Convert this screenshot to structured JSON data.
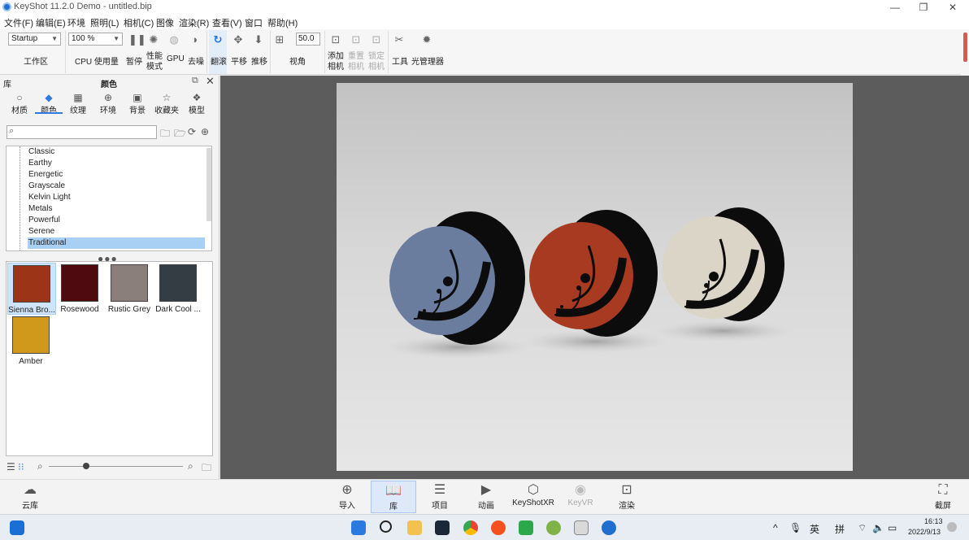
{
  "window": {
    "title": "KeyShot 11.2.0 Demo - untitled.bip",
    "controls": [
      "—",
      "❐",
      "✕"
    ]
  },
  "menu": [
    "文件(F)",
    "编辑(E)",
    "环境",
    "照明(L)",
    "相机(C)",
    "图像",
    "渲染(R)",
    "查看(V)",
    "窗口",
    "帮助(H)"
  ],
  "toolbar": {
    "workspace_value": "Startup",
    "workspace_label": "工作区",
    "cpu_value": "100 %",
    "cpu_label": "CPU 使用量",
    "pause": "暂停",
    "perf_mode_1": "性能",
    "perf_mode_2": "模式",
    "gpu": "GPU",
    "denoise": "去噪",
    "tumble": "翻滚",
    "pan": "平移",
    "dolly": "推移",
    "fov_value": "50.0",
    "fov_label": "视角",
    "add_cam_1": "添加",
    "add_cam_2": "相机",
    "reset_cam_1": "重置",
    "reset_cam_2": "相机",
    "lock_cam_1": "锁定",
    "lock_cam_2": "相机",
    "tools": "工具",
    "light_manager": "光管理器"
  },
  "library": {
    "header_left": "库",
    "header_center": "颜色",
    "tabs": [
      "材质",
      "颜色",
      "纹理",
      "环境",
      "背景",
      "收藏夹",
      "模型"
    ],
    "search_placeholder": "",
    "tree": [
      "Classic",
      "Earthy",
      "Energetic",
      "Grayscale",
      "Kelvin Light",
      "Metals",
      "Powerful",
      "Serene",
      "Traditional"
    ],
    "selected_tree": "Traditional",
    "swatches": [
      {
        "name": "Sienna Bro...",
        "color": "#9c3518"
      },
      {
        "name": "Rosewood",
        "color": "#4f0a10"
      },
      {
        "name": "Rustic Grey",
        "color": "#8a7f7a"
      },
      {
        "name": "Dark Cool ...",
        "color": "#343d44"
      },
      {
        "name": "Amber",
        "color": "#d1991c"
      }
    ]
  },
  "scene": {
    "objects": [
      {
        "color": "#6b7d9e"
      },
      {
        "color": "#a93a22"
      },
      {
        "color": "#dbd5c7"
      }
    ]
  },
  "bottom": [
    "云库",
    "导入",
    "库",
    "项目",
    "动画",
    "KeyShotXR",
    "KeyVR",
    "渲染",
    "截屏"
  ],
  "taskbar": {
    "ime1": "英",
    "ime2": "拼",
    "time": "16:13",
    "date": "2022/9/13"
  }
}
